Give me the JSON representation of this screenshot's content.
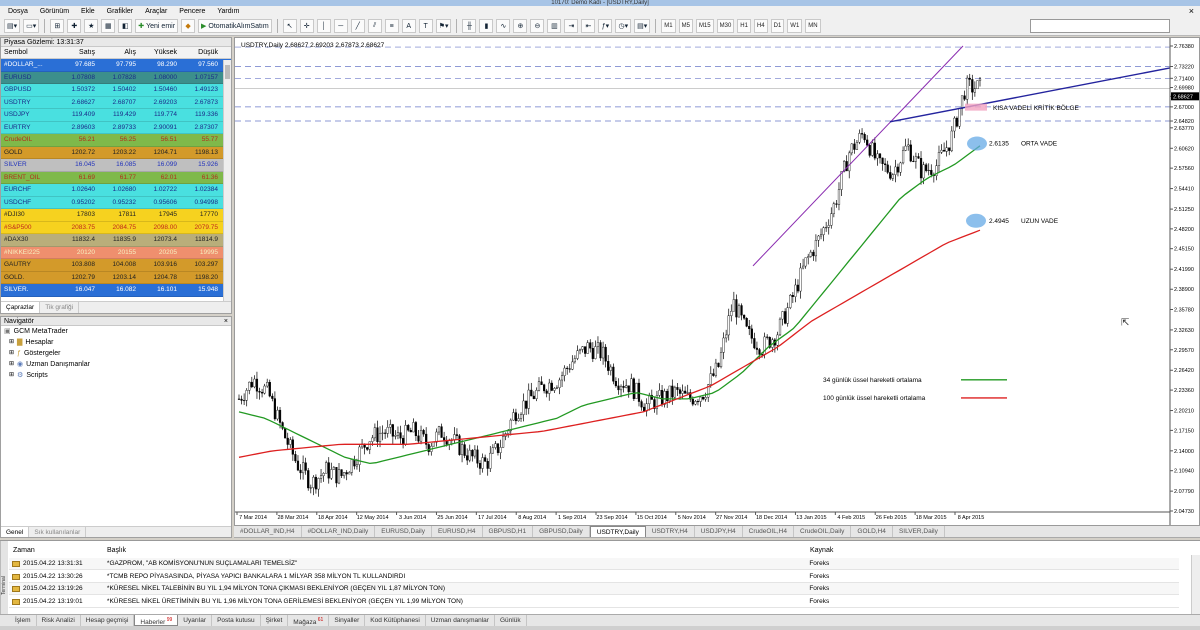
{
  "window": {
    "title": "10170: Demo  Kadı  - [USDTRY,Daily]"
  },
  "menu": [
    "Dosya",
    "Görünüm",
    "Ekle",
    "Grafikler",
    "Araçlar",
    "Pencere",
    "Yardım"
  ],
  "toolbar": {
    "new_order": "Yeni emir",
    "auto_trading": "OtomatikAlımSatım",
    "timeframes": [
      "M1",
      "M5",
      "M15",
      "M30",
      "H1",
      "H4",
      "D1",
      "W1",
      "MN"
    ]
  },
  "market_watch": {
    "title": "Piyasa Gözlemi: 13:31:37",
    "columns": [
      "Sembol",
      "Satış",
      "Alış",
      "Yüksek",
      "Düşük"
    ],
    "rows": [
      {
        "symbol": "#DOLLAR_...",
        "bid": "97.685",
        "ask": "97.795",
        "high": "98.290",
        "low": "97.560",
        "bg": "#2a6fd6",
        "fg": "#ffffff"
      },
      {
        "symbol": "EURUSD",
        "bid": "1.07808",
        "ask": "1.07828",
        "high": "1.08000",
        "low": "1.07157",
        "bg": "#3c8f8c",
        "fg": "#1a2a88"
      },
      {
        "symbol": "GBPUSD",
        "bid": "1.50372",
        "ask": "1.50402",
        "high": "1.50460",
        "low": "1.49123",
        "bg": "#49e0e0",
        "fg": "#1a2a88"
      },
      {
        "symbol": "USDTRY",
        "bid": "2.68627",
        "ask": "2.68707",
        "high": "2.69203",
        "low": "2.67873",
        "bg": "#49e0e0",
        "fg": "#1a2a88"
      },
      {
        "symbol": "USDJPY",
        "bid": "119.409",
        "ask": "119.429",
        "high": "119.774",
        "low": "119.336",
        "bg": "#49e0e0",
        "fg": "#1a2a88"
      },
      {
        "symbol": "EURTRY",
        "bid": "2.89603",
        "ask": "2.89733",
        "high": "2.90091",
        "low": "2.87307",
        "bg": "#49e0e0",
        "fg": "#1a2a88"
      },
      {
        "symbol": "CrudeOIL",
        "bid": "56.21",
        "ask": "56.25",
        "high": "56.51",
        "low": "55.77",
        "bg": "#7fb94a",
        "fg": "#b0301c"
      },
      {
        "symbol": "GOLD",
        "bid": "1202.72",
        "ask": "1203.22",
        "high": "1204.71",
        "low": "1198.13",
        "bg": "#d39a2a",
        "fg": "#222222"
      },
      {
        "symbol": "SILVER",
        "bid": "16.045",
        "ask": "16.085",
        "high": "16.099",
        "low": "15.926",
        "bg": "#bfbfbf",
        "fg": "#2233bb"
      },
      {
        "symbol": "BRENT_OIL",
        "bid": "61.69",
        "ask": "61.77",
        "high": "62.01",
        "low": "61.36",
        "bg": "#7fb94a",
        "fg": "#b0301c"
      },
      {
        "symbol": "EURCHF",
        "bid": "1.02640",
        "ask": "1.02680",
        "high": "1.02722",
        "low": "1.02384",
        "bg": "#49e0e0",
        "fg": "#1a2a88"
      },
      {
        "symbol": "USDCHF",
        "bid": "0.95202",
        "ask": "0.95232",
        "high": "0.95606",
        "low": "0.94998",
        "bg": "#49e0e0",
        "fg": "#1a2a88"
      },
      {
        "symbol": "#DJI30",
        "bid": "17803",
        "ask": "17811",
        "high": "17945",
        "low": "17770",
        "bg": "#f6d21f",
        "fg": "#222222"
      },
      {
        "symbol": "#S&P500",
        "bid": "2083.75",
        "ask": "2084.75",
        "high": "2098.00",
        "low": "2079.75",
        "bg": "#f6d21f",
        "fg": "#c0281c"
      },
      {
        "symbol": "#DAX30",
        "bid": "11832.4",
        "ask": "11835.9",
        "high": "12073.4",
        "low": "11814.9",
        "bg": "#b9ae7a",
        "fg": "#222222"
      },
      {
        "symbol": "#NIKKEI225",
        "bid": "20120",
        "ask": "20155",
        "high": "20205",
        "low": "19995",
        "bg": "#ef8f6e",
        "fg": "#f6f0c0"
      },
      {
        "symbol": "GAUTRY",
        "bid": "103.808",
        "ask": "104.008",
        "high": "103.916",
        "low": "103.297",
        "bg": "#d39a2a",
        "fg": "#222222"
      },
      {
        "symbol": "GOLD.",
        "bid": "1202.79",
        "ask": "1203.14",
        "high": "1204.78",
        "low": "1198.20",
        "bg": "#d39a2a",
        "fg": "#222222"
      },
      {
        "symbol": "SILVER.",
        "bid": "16.047",
        "ask": "16.082",
        "high": "16.101",
        "low": "15.948",
        "bg": "#2a6fd6",
        "fg": "#ffffff"
      }
    ],
    "tabs": [
      "Çaprazlar",
      "Tik grafiği"
    ]
  },
  "navigator": {
    "title": "Navigatör",
    "root": "GCM MetaTrader",
    "items": [
      "Hesaplar",
      "Göstergeler",
      "Uzman Danışmanlar",
      "Scripts"
    ],
    "tabs": [
      "Genel",
      "Sık kullanılanlar"
    ]
  },
  "chart_data": {
    "type": "candlestick",
    "symbol": "USDTRY,Daily",
    "header": "USDTRY,Daily  2.68627 2.69203 2.67873 2.68627",
    "y_ticks": [
      "2.76380",
      "2.73220",
      "2.71400",
      "2.69980",
      "2.68627",
      "2.67000",
      "2.64820",
      "2.63770",
      "2.60620",
      "2.57560",
      "2.54410",
      "2.51250",
      "2.48200",
      "2.45150",
      "2.41990",
      "2.38900",
      "2.35780",
      "2.32630",
      "2.29570",
      "2.26420",
      "2.23360",
      "2.20210",
      "2.17150",
      "2.14000",
      "2.10940",
      "2.07790",
      "2.04730"
    ],
    "ylim": [
      2.0473,
      2.7638
    ],
    "x_ticks": [
      "7 Mar 2014",
      "28 Mar 2014",
      "18 Apr 2014",
      "12 May 2014",
      "3 Jun 2014",
      "25 Jun 2014",
      "17 Jul 2014",
      "8 Aug 2014",
      "1 Sep 2014",
      "23 Sep 2014",
      "15 Oct 2014",
      "5 Nov 2014",
      "27 Nov 2014",
      "18 Dec 2014",
      "13 Jan 2015",
      "4 Feb 2015",
      "26 Feb 2015",
      "18 Mar 2015",
      "8 Apr 2015"
    ],
    "series": [
      {
        "name": "USDTRY",
        "close_anchors": [
          2.22,
          2.25,
          2.23,
          2.17,
          2.12,
          2.09,
          2.11,
          2.1,
          2.13,
          2.16,
          2.17,
          2.16,
          2.17,
          2.15,
          2.17,
          2.15,
          2.13,
          2.12,
          2.15,
          2.2,
          2.22,
          2.24,
          2.25,
          2.28,
          2.3,
          2.29,
          2.25,
          2.24,
          2.21,
          2.22,
          2.23,
          2.22,
          2.23,
          2.27,
          2.37,
          2.32,
          2.3,
          2.32,
          2.37,
          2.43,
          2.47,
          2.52,
          2.6,
          2.63,
          2.58,
          2.57,
          2.61,
          2.57,
          2.58,
          2.62,
          2.7,
          2.7
        ],
        "color": "#000000"
      },
      {
        "name": "34 günlük üssel hareketli ortalama",
        "anchors": [
          2.2,
          2.19,
          2.17,
          2.15,
          2.13,
          2.12,
          2.13,
          2.14,
          2.15,
          2.16,
          2.17,
          2.18,
          2.19,
          2.21,
          2.22,
          2.23,
          2.22,
          2.22,
          2.23,
          2.26,
          2.3,
          2.33,
          2.38,
          2.43,
          2.48,
          2.53,
          2.56,
          2.58,
          2.61
        ],
        "color": "#229922"
      },
      {
        "name": "100 günlük üssel hareketli ortalama",
        "anchors": [
          2.13,
          2.14,
          2.145,
          2.15,
          2.15,
          2.15,
          2.155,
          2.16,
          2.165,
          2.17,
          2.18,
          2.19,
          2.2,
          2.22,
          2.24,
          2.27,
          2.3,
          2.34,
          2.37,
          2.4,
          2.43,
          2.46,
          2.48
        ],
        "color": "#dd2020"
      }
    ],
    "levels": [
      {
        "label": "KISA VADELİ KRİTİK BÖLGE",
        "value": ""
      },
      {
        "label": "ORTA VADE",
        "value": "2.6135"
      },
      {
        "label": "UZUN VADE",
        "value": "2.4945"
      }
    ],
    "ask_line": "2.74900",
    "grid": false
  },
  "chart_tabs": [
    "#DOLLAR_IND,H4",
    "#DOLLAR_IND,Daily",
    "EURUSD,Daily",
    "EURUSD,H4",
    "GBPUSD,H1",
    "GBPUSD,Daily",
    "USDTRY,Daily",
    "USDTRY,H4",
    "USDJPY,H4",
    "CrudeOIL,H4",
    "CrudeOIL,Daily",
    "GOLD,H4",
    "SILVER,Daily"
  ],
  "chart_tabs_active": "USDTRY,Daily",
  "terminal": {
    "side_label": "Terminal",
    "columns": [
      "Zaman",
      "Başlık",
      "Kaynak"
    ],
    "rows": [
      {
        "time": "2015.04.22 13:31:31",
        "title": "*GAZPROM, \"AB KOMİSYONU'NUN SUÇLAMALARI TEMELSİZ\"",
        "source": "Foreks"
      },
      {
        "time": "2015.04.22 13:30:26",
        "title": "*TCMB REPO PİYASASINDA, PİYASA YAPICI BANKALARA 1 MİLYAR 358 MİLYON TL KULLANDIRDI",
        "source": "Foreks"
      },
      {
        "time": "2015.04.22 13:19:26",
        "title": "*KÜRESEL NİKEL TALEBİNİN BU YIL 1,94 MİLYON TONA ÇIKMASI BEKLENİYOR (GEÇEN YIL 1,87 MİLYON TON)",
        "source": "Foreks"
      },
      {
        "time": "2015.04.22 13:19:01",
        "title": "*KÜRESEL NİKEL ÜRETİMİNİN BU YIL 1,96 MİLYON TONA GERİLEMESİ BEKLENİYOR (GEÇEN YIL 1,99 MİLYON TON)",
        "source": "Foreks"
      }
    ]
  },
  "bottom_tabs": [
    {
      "label": "İşlem",
      "badge": ""
    },
    {
      "label": "Risk Analizi",
      "badge": ""
    },
    {
      "label": "Hesap geçmişi",
      "badge": ""
    },
    {
      "label": "Haberler",
      "badge": "99"
    },
    {
      "label": "Uyarılar",
      "badge": ""
    },
    {
      "label": "Posta kutusu",
      "badge": ""
    },
    {
      "label": "Şirket",
      "badge": ""
    },
    {
      "label": "Mağaza",
      "badge": "61"
    },
    {
      "label": "Sinyaller",
      "badge": ""
    },
    {
      "label": "Kod Kütüphanesi",
      "badge": ""
    },
    {
      "label": "Uzman danışmanlar",
      "badge": ""
    },
    {
      "label": "Günlük",
      "badge": ""
    }
  ],
  "bottom_tabs_active": "Haberler"
}
